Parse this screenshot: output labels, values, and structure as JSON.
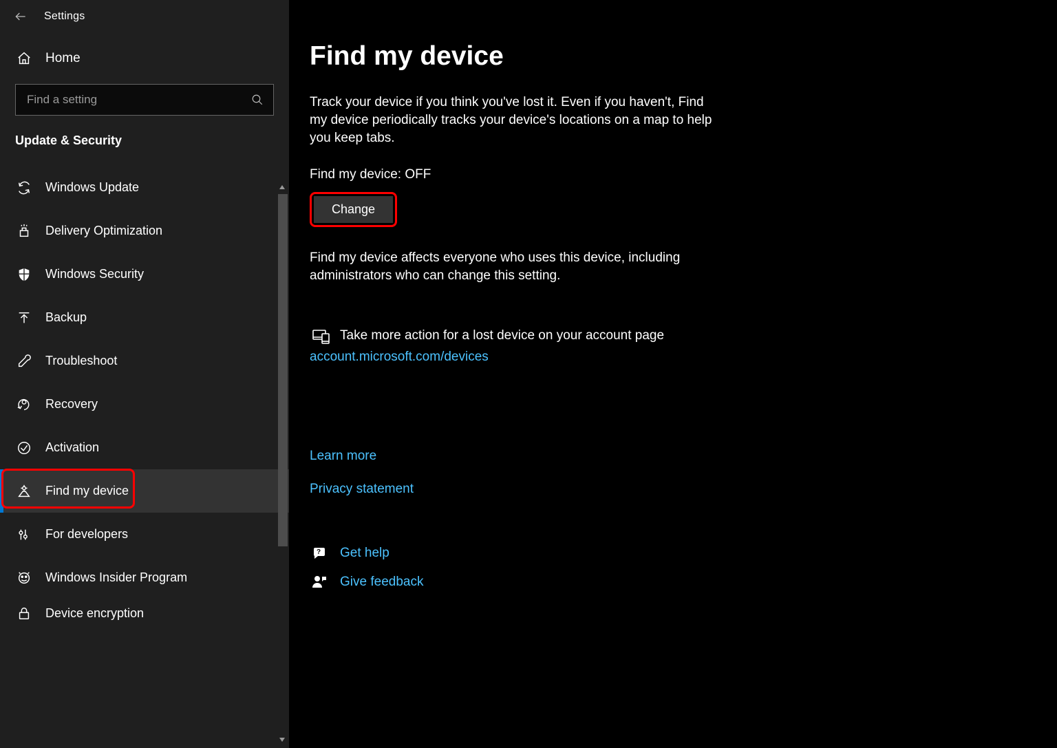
{
  "window": {
    "title": "Settings"
  },
  "sidebar": {
    "home_label": "Home",
    "search_placeholder": "Find a setting",
    "section_header": "Update & Security",
    "items": [
      {
        "label": "Windows Update"
      },
      {
        "label": "Delivery Optimization"
      },
      {
        "label": "Windows Security"
      },
      {
        "label": "Backup"
      },
      {
        "label": "Troubleshoot"
      },
      {
        "label": "Recovery"
      },
      {
        "label": "Activation"
      },
      {
        "label": "Find my device"
      },
      {
        "label": "For developers"
      },
      {
        "label": "Windows Insider Program"
      },
      {
        "label": "Device encryption"
      }
    ]
  },
  "main": {
    "title": "Find my device",
    "description": "Track your device if you think you've lost it. Even if you haven't, Find my device periodically tracks your device's locations on a map to help you keep tabs.",
    "status_label": "Find my device: OFF",
    "change_button": "Change",
    "note": "Find my device affects everyone who uses this device, including administrators who can change this setting.",
    "more_action_text": "Take more action for a lost device on your account page",
    "account_link": "account.microsoft.com/devices",
    "learn_more": "Learn more",
    "privacy_statement": "Privacy statement",
    "get_help": "Get help",
    "give_feedback": "Give feedback"
  }
}
